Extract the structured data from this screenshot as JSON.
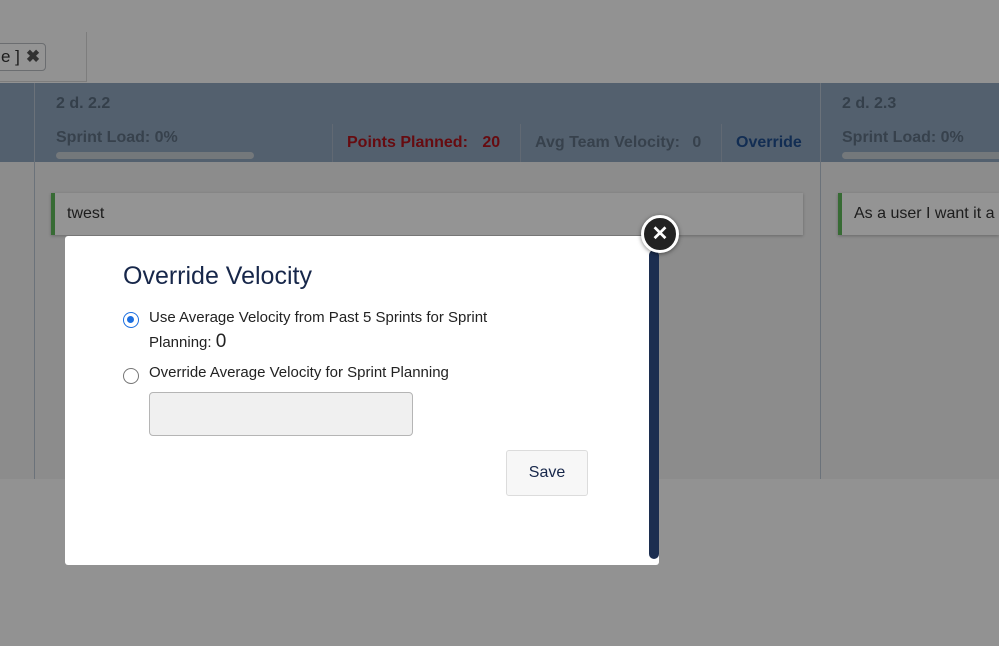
{
  "filter": {
    "tag_text": "e ]",
    "remove_icon": "close-icon"
  },
  "columns": [
    {
      "title": "2 d. 2.2",
      "sprint_load": "Sprint Load: 0%",
      "points_planned_label": "Points Planned:",
      "points_planned_value": "20",
      "avg_velocity_label": "Avg Team Velocity:",
      "avg_velocity_value": "0",
      "override_link": "Override",
      "card": "twest"
    },
    {
      "title": "2 d. 2.3",
      "sprint_load": "Sprint Load: 0%",
      "card": "As a user I want it a"
    }
  ],
  "modal": {
    "title": "Override Velocity",
    "option_average_text": "Use Average Velocity from Past 5 Sprints for Sprint Planning:",
    "option_average_value": "0",
    "option_override_text": "Override Average Velocity for Sprint Planning",
    "velocity_input_value": "",
    "save_label": "Save",
    "close_icon": "close-icon",
    "selected_option": "average"
  },
  "colors": {
    "accent": "#1d6fe0",
    "points_planned": "#b0141c",
    "override_link": "#1f4f8f",
    "card_stripe": "#5fb85a"
  }
}
